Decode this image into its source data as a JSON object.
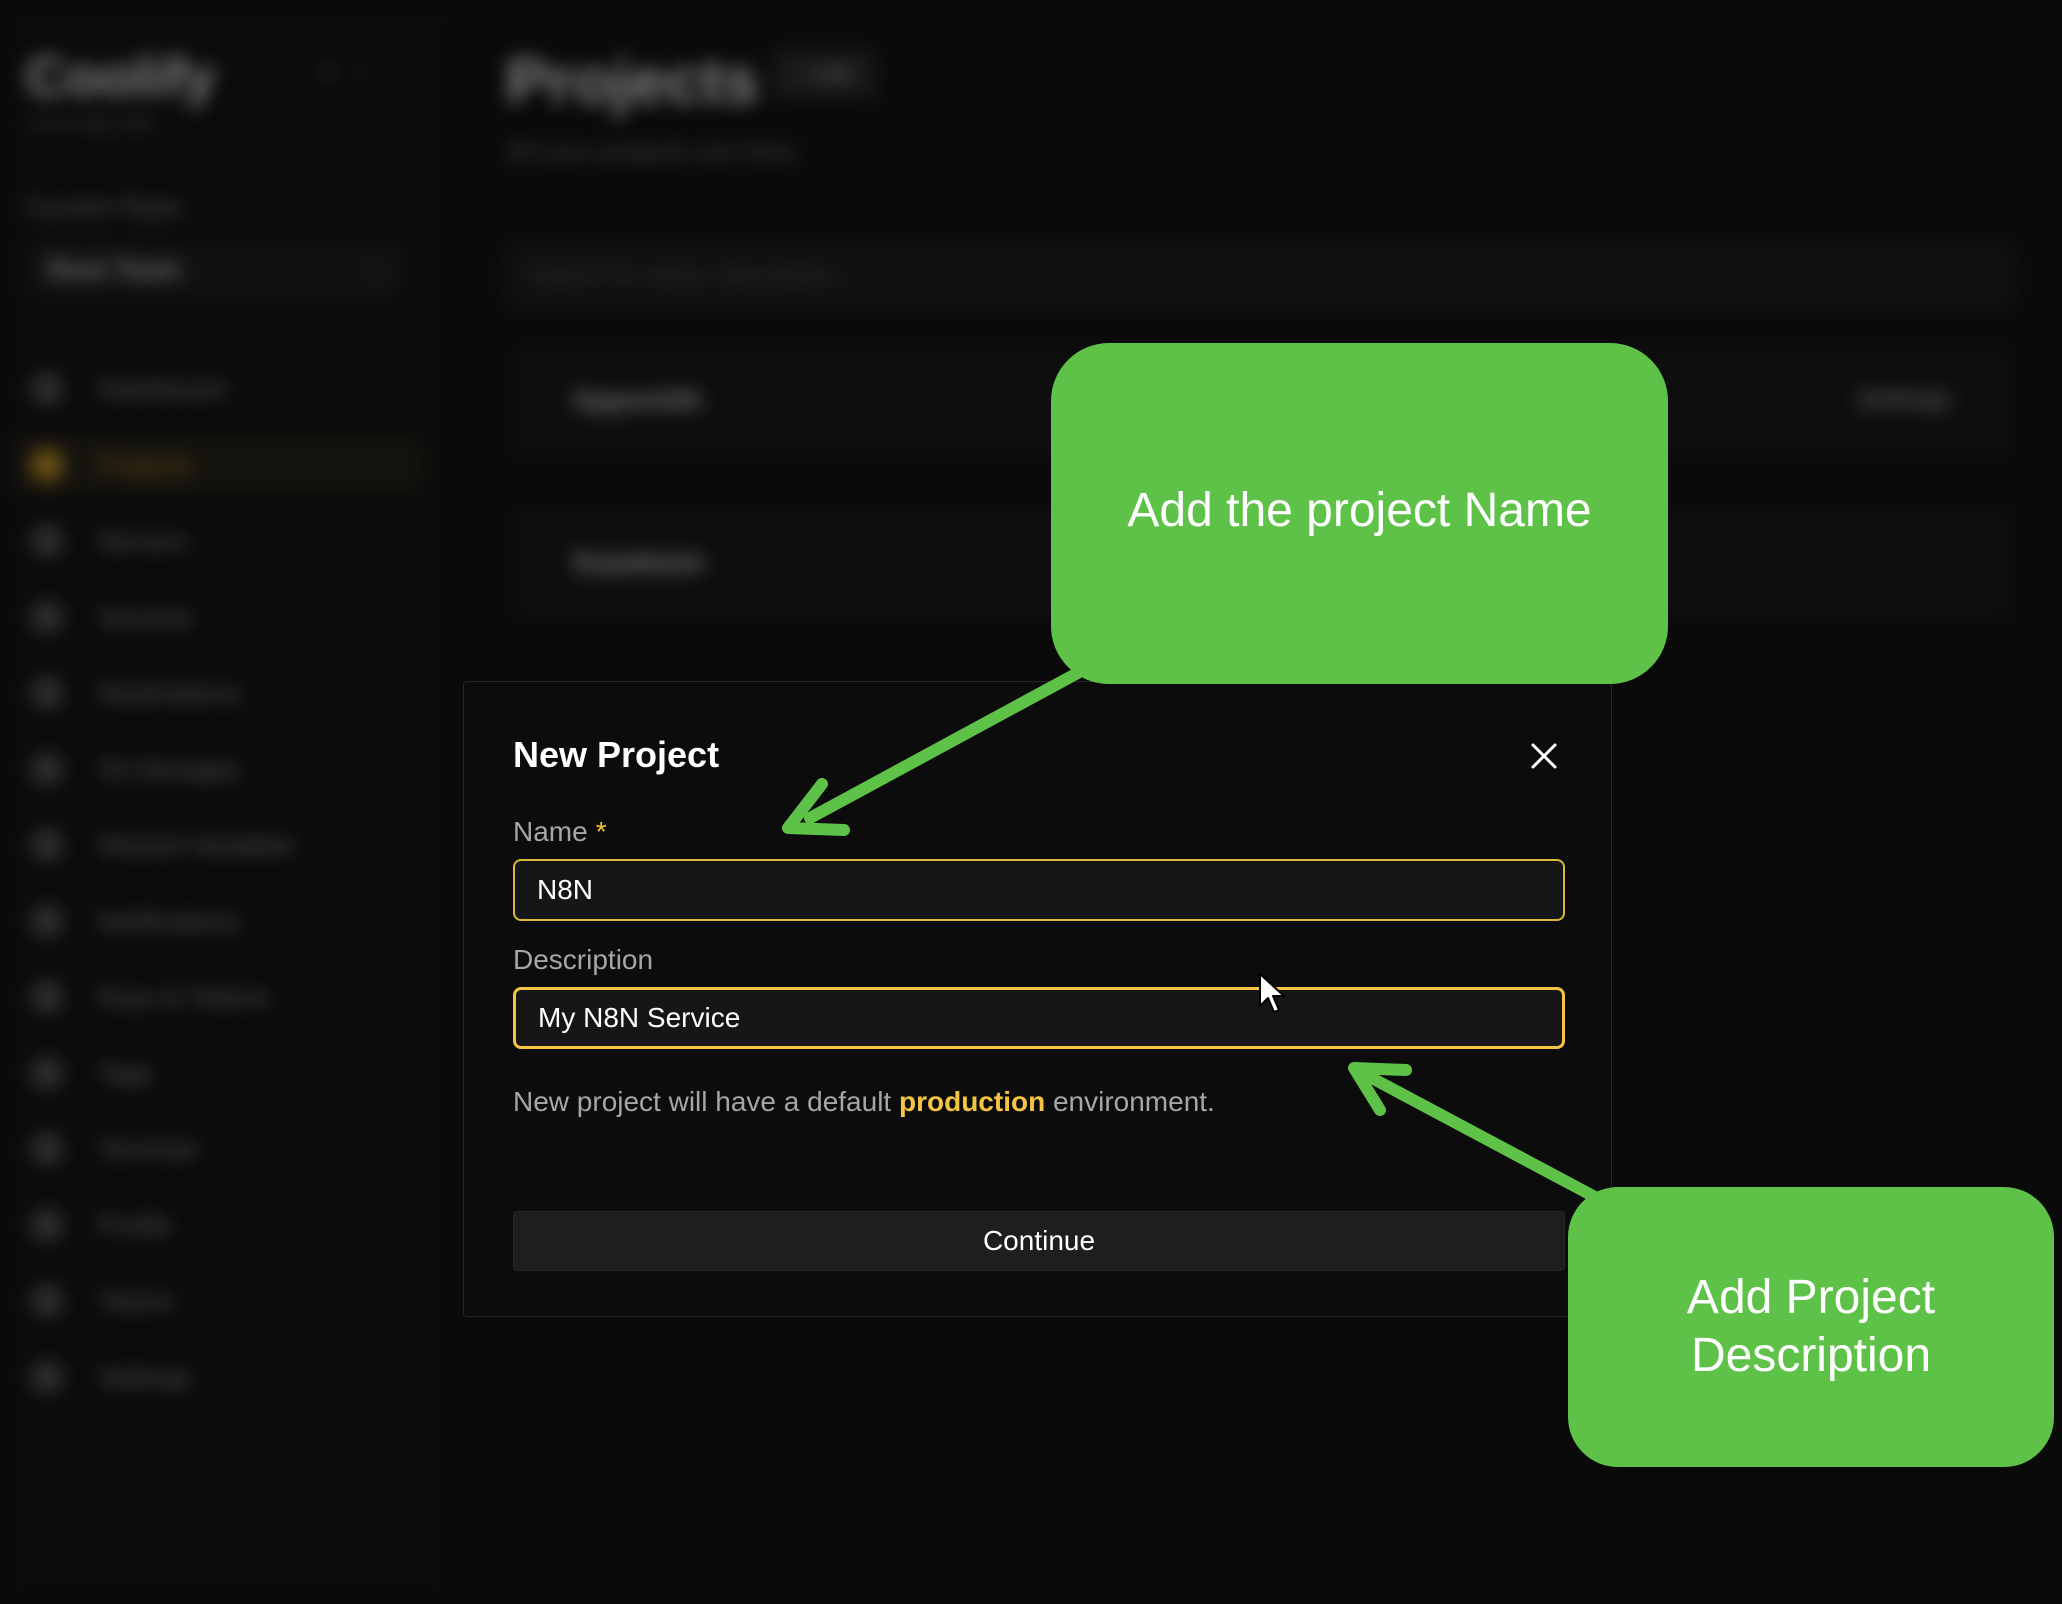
{
  "sidebar": {
    "brand": "Coolify",
    "version": "v4.0.0-beta.360",
    "team_label": "Current Team",
    "team_value": "Root Team",
    "items": [
      {
        "label": "Dashboard",
        "active": false
      },
      {
        "label": "Projects",
        "active": true
      },
      {
        "label": "Servers",
        "active": false
      },
      {
        "label": "Sources",
        "active": false
      },
      {
        "label": "Destinations",
        "active": false
      },
      {
        "label": "S3 Storages",
        "active": false
      },
      {
        "label": "Shared Variables",
        "active": false
      },
      {
        "label": "Notifications",
        "active": false
      },
      {
        "label": "Keys & Tokens",
        "active": false
      },
      {
        "label": "Tags",
        "active": false
      },
      {
        "label": "Terminal",
        "active": false
      },
      {
        "label": "Profile",
        "active": false
      },
      {
        "label": "Teams",
        "active": false
      },
      {
        "label": "Settings",
        "active": false
      }
    ]
  },
  "main": {
    "title": "Projects",
    "add_label": "+ Add",
    "subtitle": "All your projects are here.",
    "search_placeholder": "Search for name, description...",
    "projects": [
      {
        "name": "Appsmith",
        "settings_label": "Settings"
      },
      {
        "name": "Supabase",
        "settings_label": ""
      }
    ]
  },
  "modal": {
    "title": "New Project",
    "name_label": "Name",
    "required_mark": "*",
    "name_value": "N8N",
    "description_label": "Description",
    "description_value": "My N8N Service",
    "helper_prefix": "New project will have a default ",
    "helper_highlight": "production",
    "helper_suffix": " environment.",
    "continue_label": "Continue"
  },
  "annotations": {
    "name_callout": "Add the project Name",
    "description_callout": "Add Project Description"
  },
  "colors": {
    "accent": "#f5c542",
    "callout_green": "#5ec249",
    "background": "#0a0a0a"
  },
  "icons": {
    "close": "close-icon",
    "cursor": "mouse-pointer-icon"
  }
}
